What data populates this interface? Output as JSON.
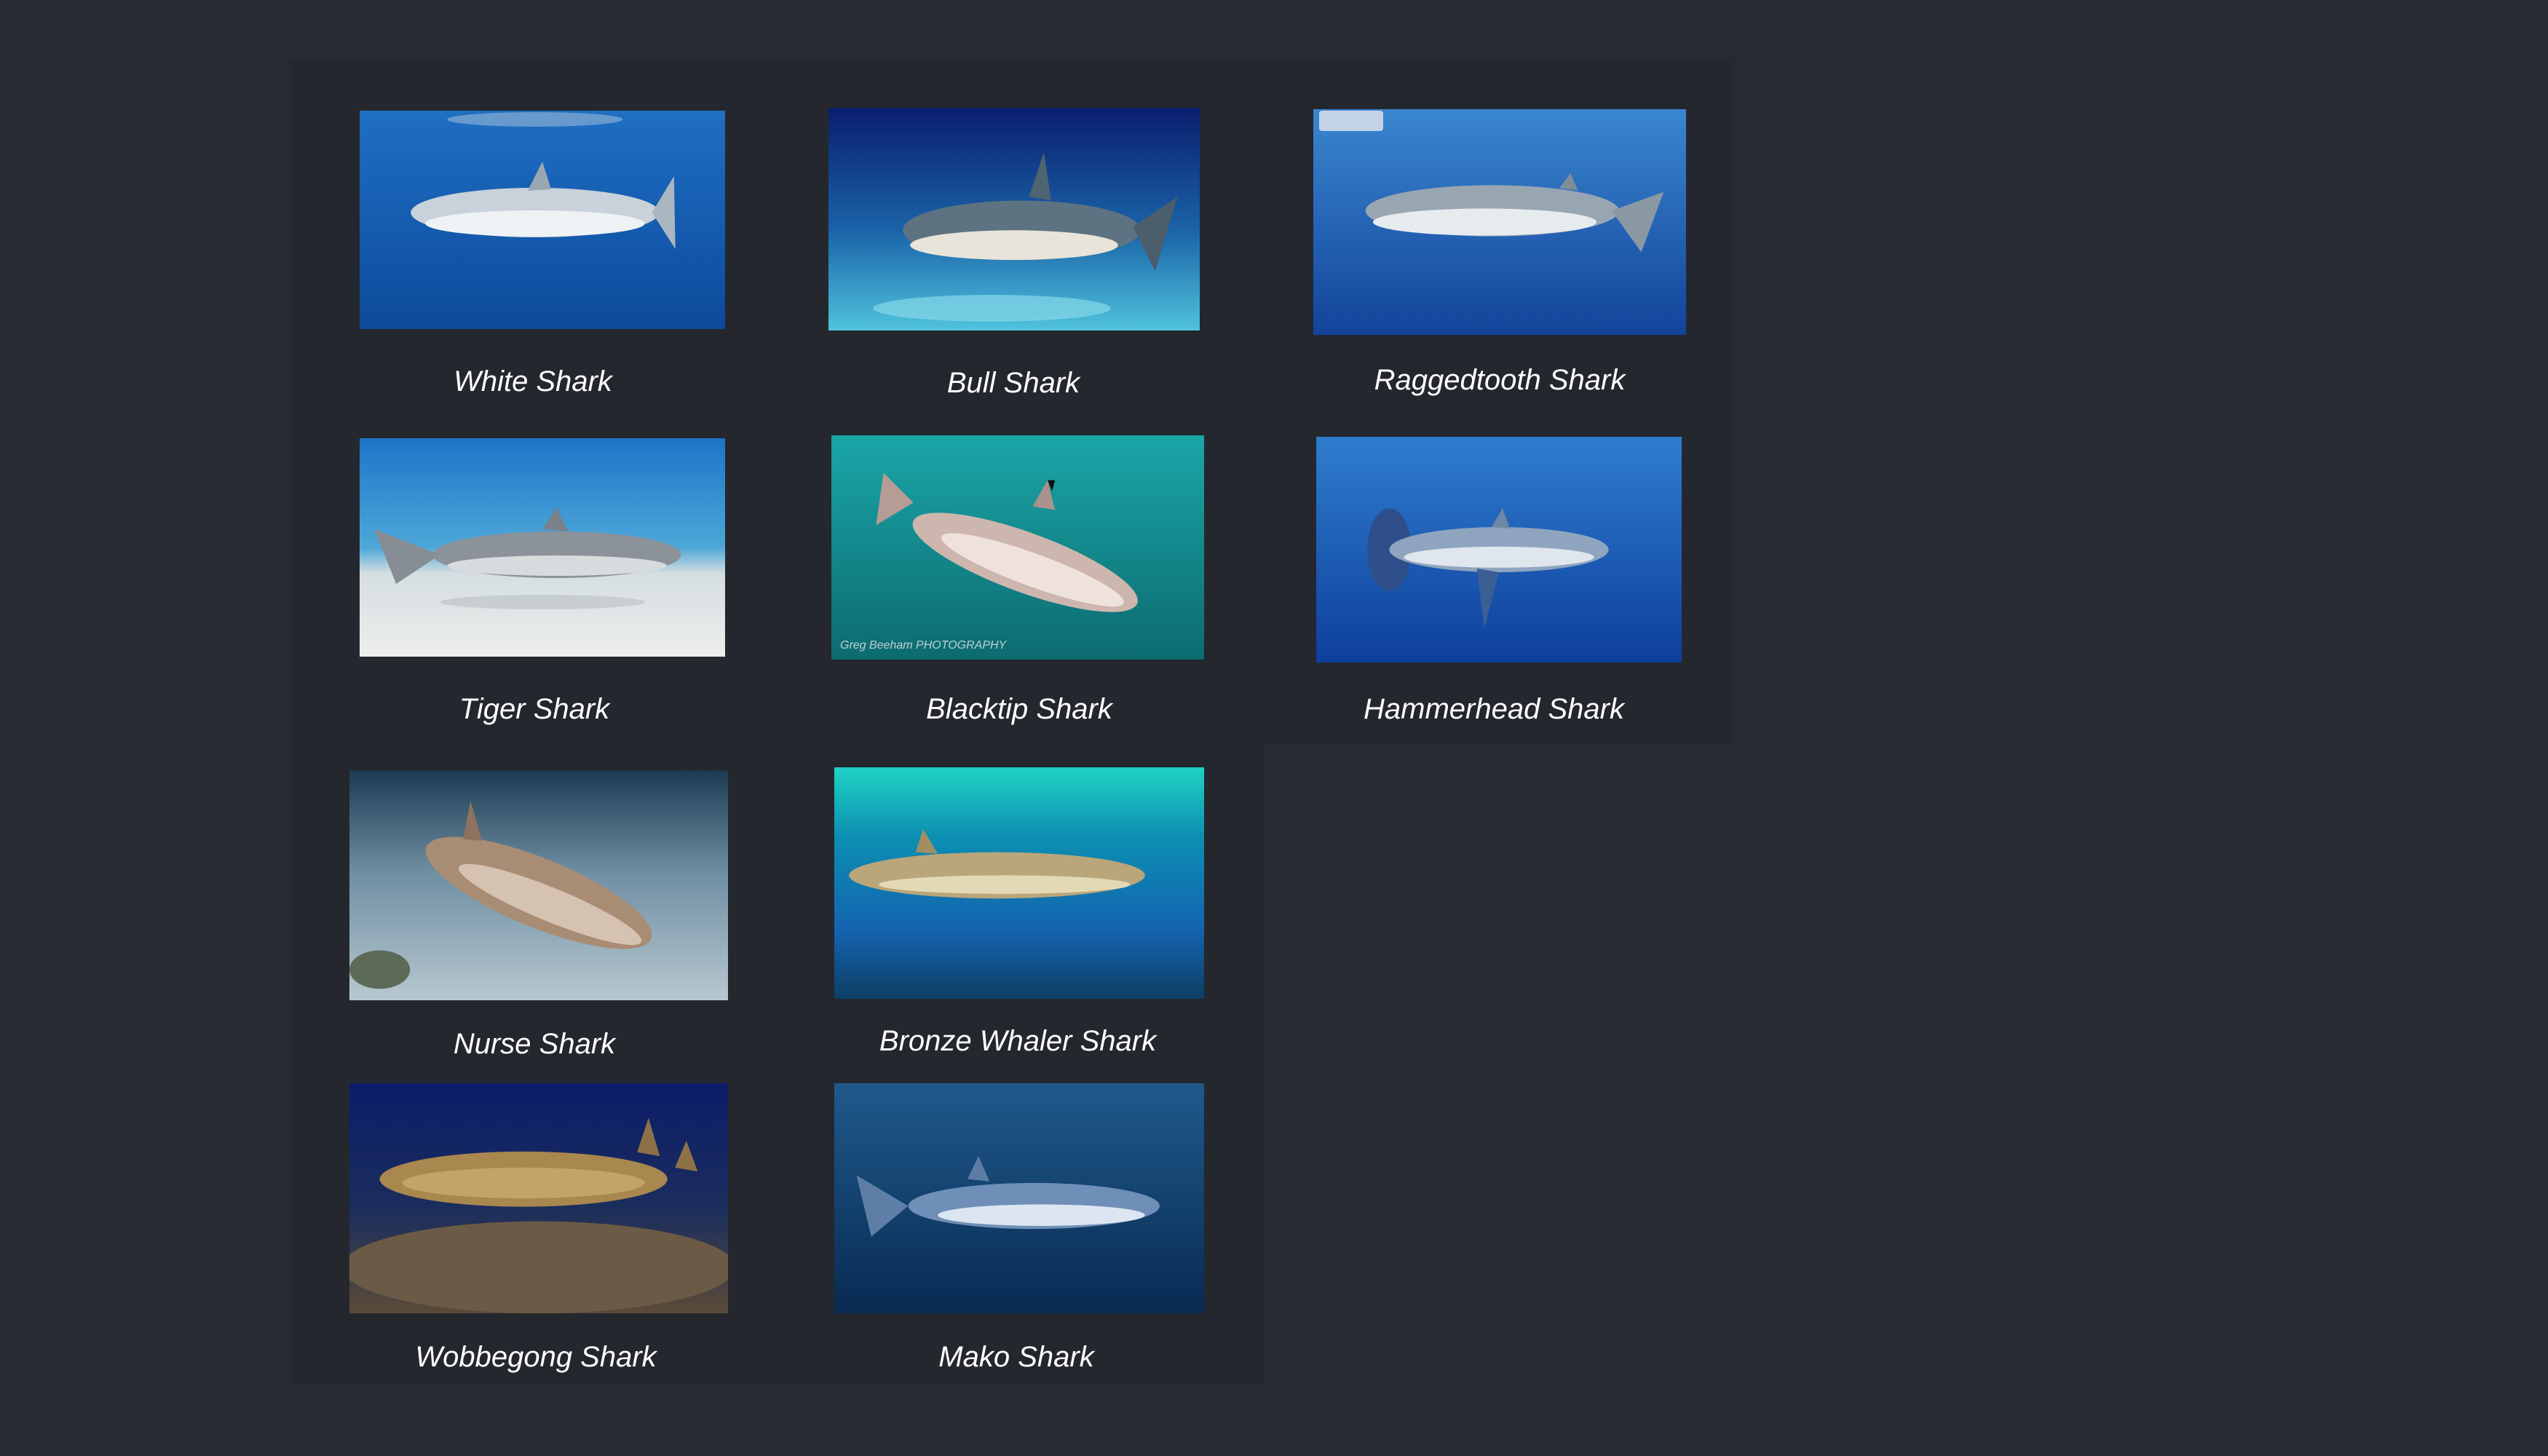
{
  "gallery": {
    "items": [
      {
        "label": "White Shark",
        "icon": "white-shark-photo"
      },
      {
        "label": "Bull Shark",
        "icon": "bull-shark-photo"
      },
      {
        "label": "Raggedtooth Shark",
        "icon": "raggedtooth-shark-photo"
      },
      {
        "label": "Tiger Shark",
        "icon": "tiger-shark-photo"
      },
      {
        "label": "Blacktip Shark",
        "icon": "blacktip-shark-photo"
      },
      {
        "label": "Hammerhead Shark",
        "icon": "hammerhead-shark-photo"
      },
      {
        "label": "Nurse Shark",
        "icon": "nurse-shark-photo"
      },
      {
        "label": "Bronze Whaler Shark",
        "icon": "bronze-whaler-shark-photo"
      },
      {
        "label": "Wobbegong Shark",
        "icon": "wobbegong-shark-photo"
      },
      {
        "label": "Mako Shark",
        "icon": "mako-shark-photo"
      }
    ]
  }
}
